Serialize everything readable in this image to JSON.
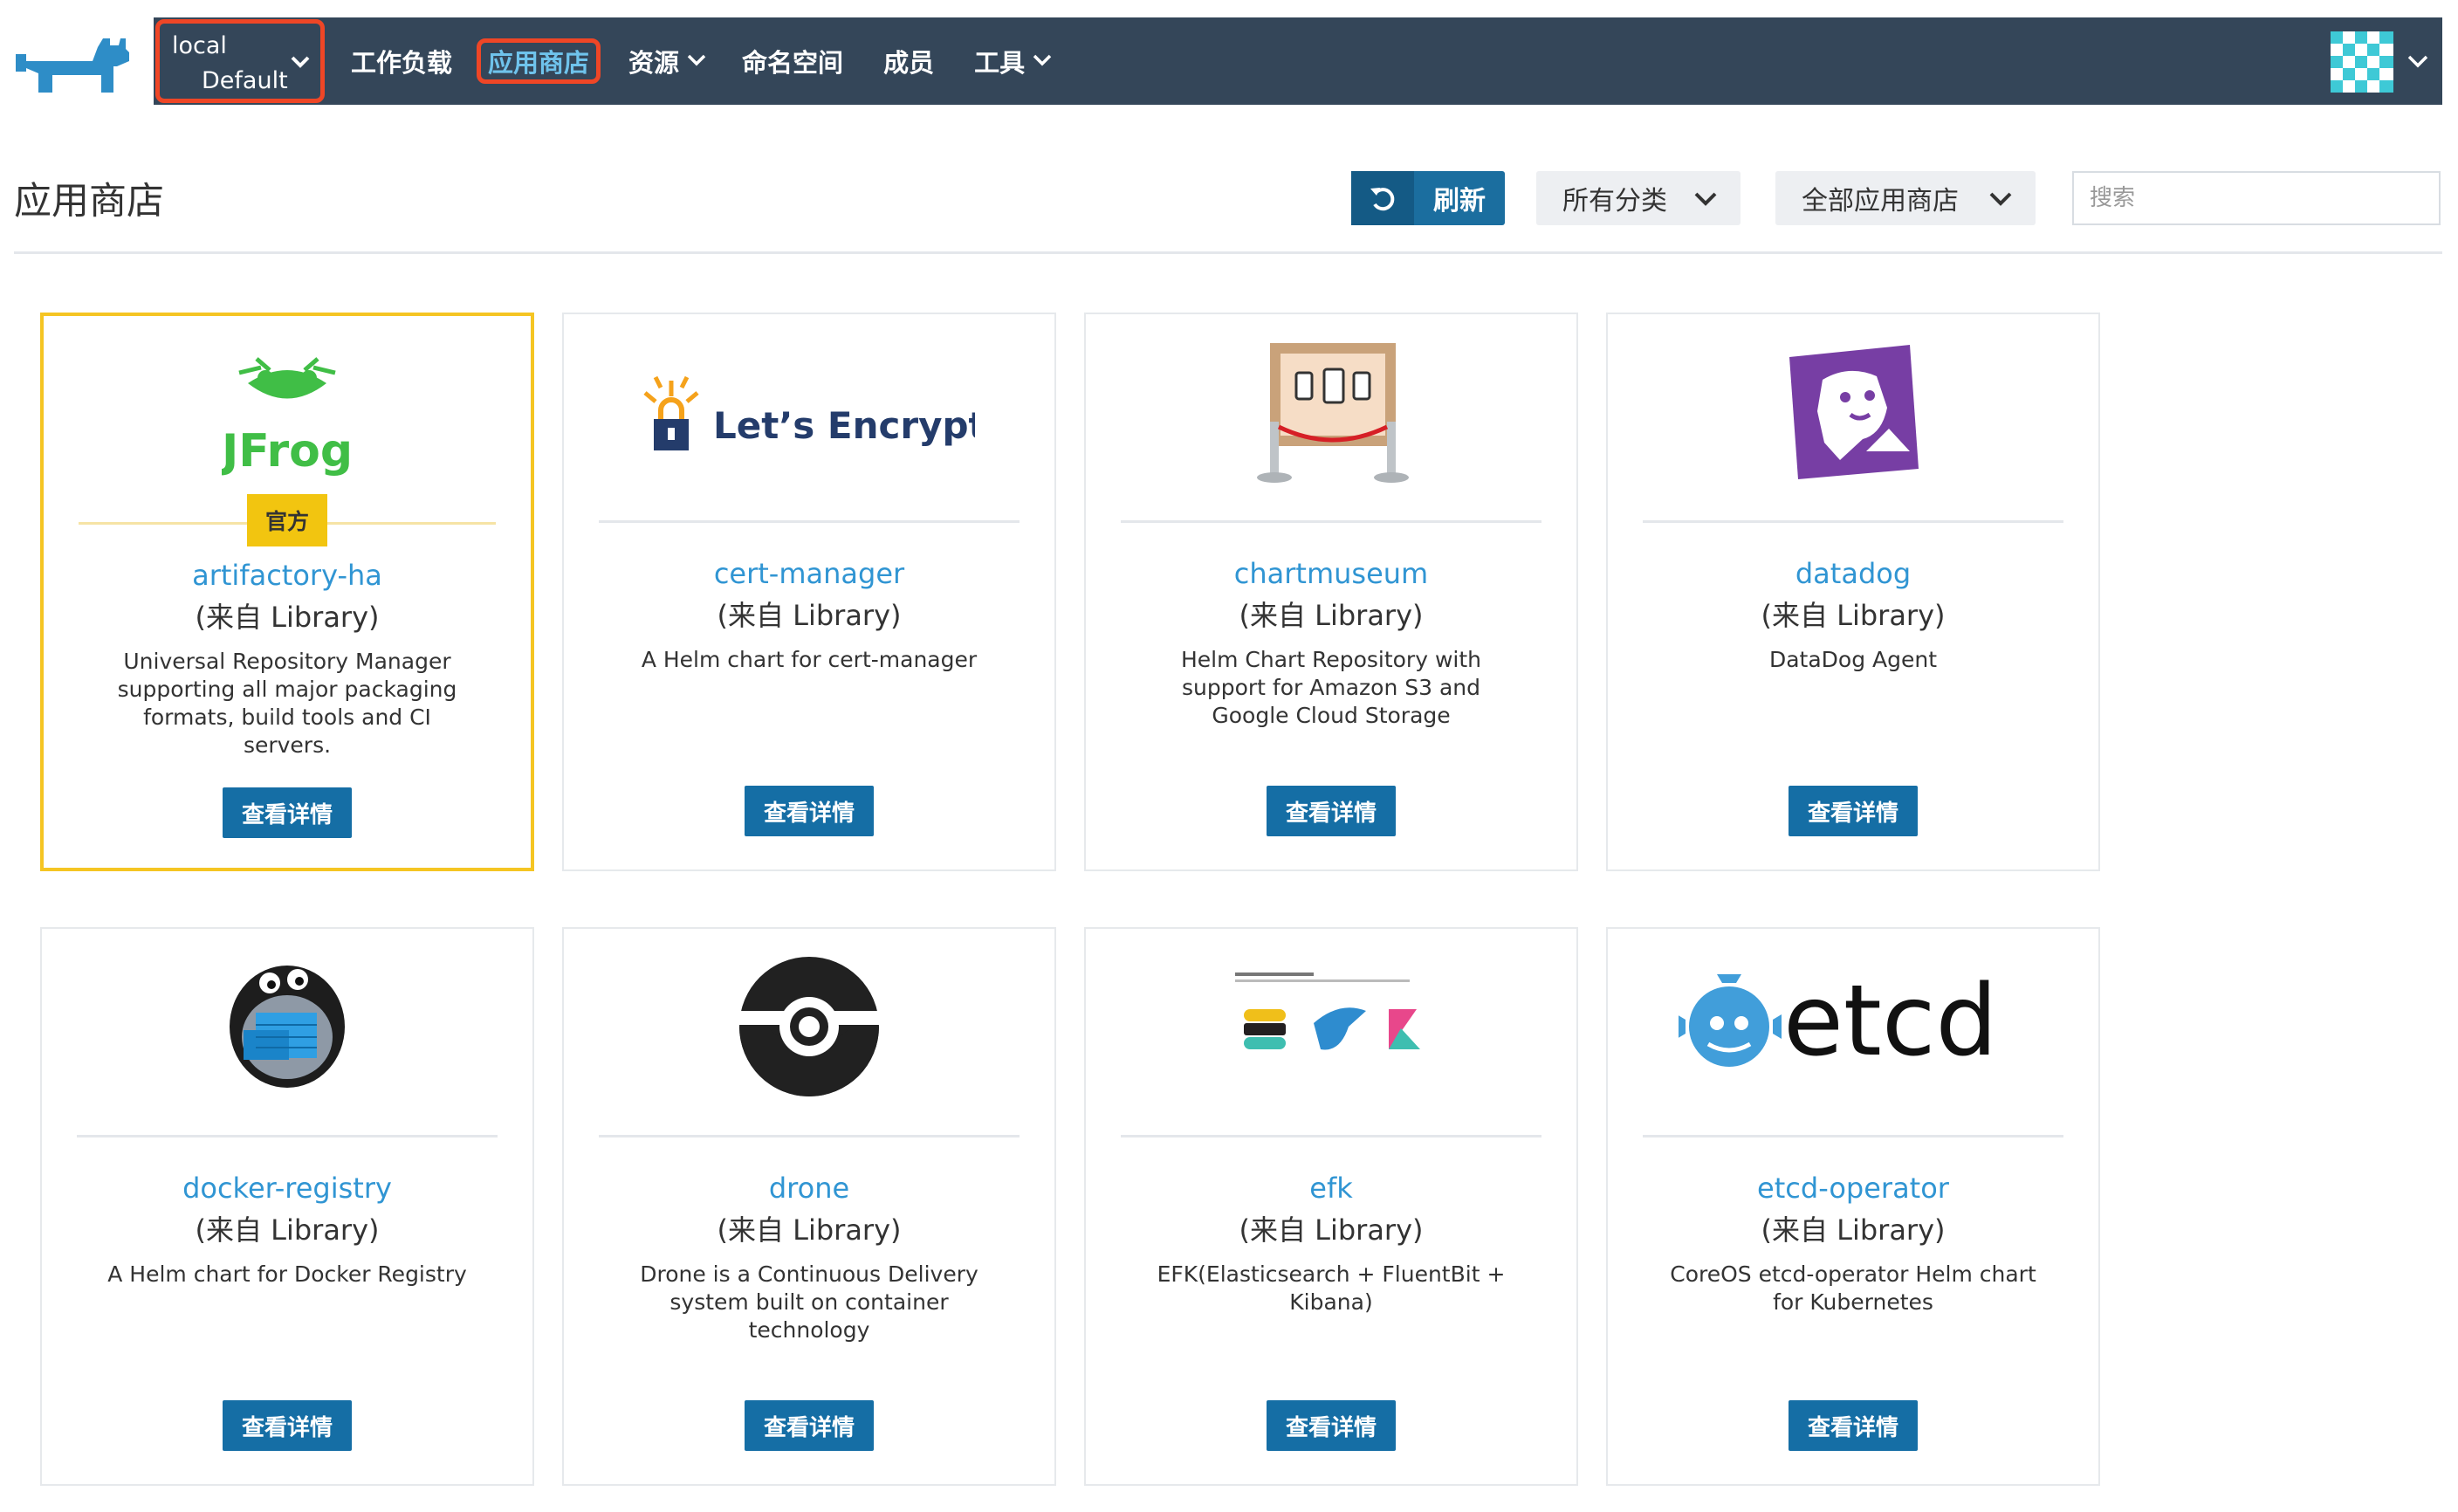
{
  "nav": {
    "cluster": "local",
    "project": "Default",
    "items": [
      {
        "label": "工作负载"
      },
      {
        "label": "应用商店"
      },
      {
        "label": "资源"
      },
      {
        "label": "命名空间"
      },
      {
        "label": "成员"
      },
      {
        "label": "工具"
      }
    ]
  },
  "header": {
    "title": "应用商店",
    "refresh_label": "刷新",
    "category_select": "所有分类",
    "catalog_select": "全部应用商店",
    "search_placeholder": "搜索"
  },
  "cards": [
    {
      "name": "artifactory-ha",
      "source": "(来自 Library)",
      "badge": "官方",
      "description": "Universal Repository Manager supporting all major packaging formats, build tools and CI servers.",
      "button": "查看详情",
      "logo_text": "JFrog"
    },
    {
      "name": "cert-manager",
      "source": "(来自 Library)",
      "description": "A Helm chart for cert-manager",
      "button": "查看详情",
      "logo_text": "Let’s Encrypt"
    },
    {
      "name": "chartmuseum",
      "source": "(来自 Library)",
      "description": "Helm Chart Repository with support for Amazon S3 and Google Cloud Storage",
      "button": "查看详情"
    },
    {
      "name": "datadog",
      "source": "(来自 Library)",
      "description": "DataDog Agent",
      "button": "查看详情"
    },
    {
      "name": "docker-registry",
      "source": "(来自 Library)",
      "description": "A Helm chart for Docker Registry",
      "button": "查看详情"
    },
    {
      "name": "drone",
      "source": "(来自 Library)",
      "description": "Drone is a Continuous Delivery system built on container technology",
      "button": "查看详情"
    },
    {
      "name": "efk",
      "source": "(来自 Library)",
      "description": "EFK(Elasticsearch + FluentBit + Kibana)",
      "button": "查看详情"
    },
    {
      "name": "etcd-operator",
      "source": "(来自 Library)",
      "description": "CoreOS etcd-operator Helm chart for Kubernetes",
      "button": "查看详情",
      "logo_text": "etcd"
    }
  ],
  "colors": {
    "navbar": "#344659",
    "highlight_outline": "#ef4626",
    "primary_button": "#156ea5",
    "link": "#3095d3",
    "official_badge": "#f2c510"
  }
}
